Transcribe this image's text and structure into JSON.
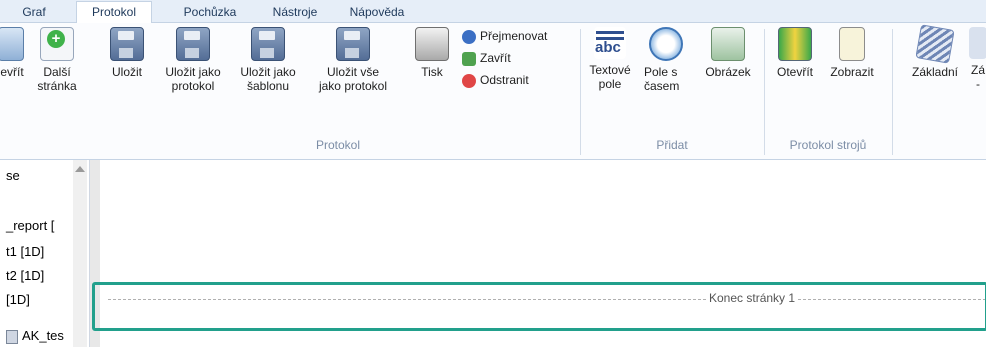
{
  "tabs": [
    {
      "label": "Graf",
      "active": false
    },
    {
      "label": "Protokol",
      "active": true
    },
    {
      "label": "Pochůzka",
      "active": false
    },
    {
      "label": "Nástroje",
      "active": false
    },
    {
      "label": "Nápověda",
      "active": false
    }
  ],
  "ribbon": {
    "open_label": "evřít",
    "next_page": [
      "Další",
      "stránka"
    ],
    "save": "Uložit",
    "save_as_protocol": [
      "Uložit jako",
      "protokol"
    ],
    "save_as_template": [
      "Uložit jako",
      "šablonu"
    ],
    "save_all": [
      "Uložit vše",
      "jako protokol"
    ],
    "print": "Tisk",
    "rename": "Přejmenovat",
    "close": "Zavřít",
    "remove": "Odstranit",
    "group_protocol": "Protokol",
    "text_field": [
      "Textové",
      "pole"
    ],
    "time_field": [
      "Pole s",
      "časem"
    ],
    "image": "Obrázek",
    "group_add": "Přidat",
    "machine_open": "Otevřít",
    "machine_show": "Zobrazit",
    "group_machine": "Protokol strojů",
    "basic": "Základní",
    "basic2": [
      "Zá",
      "-"
    ]
  },
  "sidebar": {
    "items": [
      "se",
      "_report [",
      "t1 [1D]",
      "t2 [1D]",
      "[1D]",
      "AK_tes"
    ]
  },
  "canvas": {
    "page_break_label": "Konec stránky 1"
  }
}
